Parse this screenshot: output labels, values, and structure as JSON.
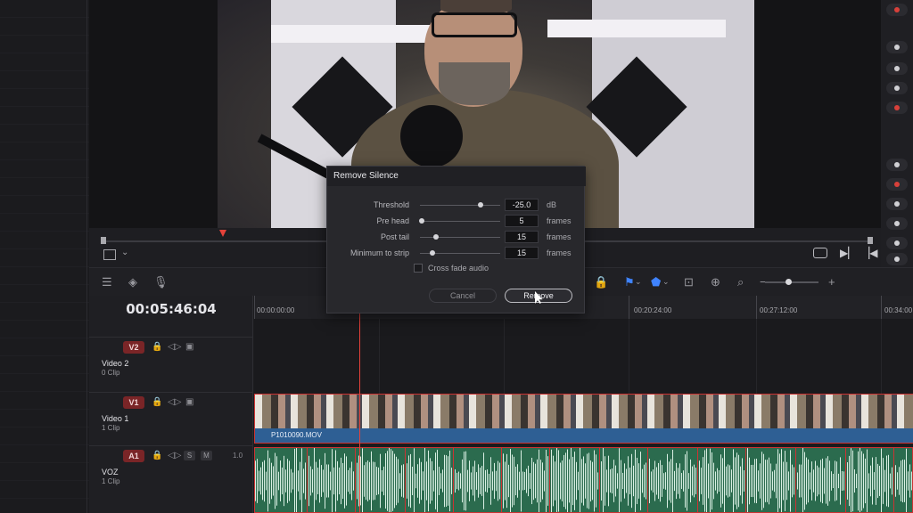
{
  "dialog": {
    "title": "Remove Silence",
    "rows": [
      {
        "label": "Threshold",
        "value": "-25.0",
        "unit": "dB",
        "level": 0.75
      },
      {
        "label": "Pre head",
        "value": "5",
        "unit": "frames",
        "level": 0.02
      },
      {
        "label": "Post tail",
        "value": "15",
        "unit": "frames",
        "level": 0.2
      },
      {
        "label": "Minimum to strip",
        "value": "15",
        "unit": "frames",
        "level": 0.15
      }
    ],
    "crossfade_label": "Cross fade audio",
    "crossfade_checked": false,
    "cancel_label": "Cancel",
    "remove_label": "Remove"
  },
  "timeline": {
    "timecode": "00:05:46:04",
    "ruler": [
      "00:00:00:00",
      "00:20:24:00",
      "00:27:12:00",
      "00:34:00"
    ],
    "tracks": {
      "v2": {
        "badge": "V2",
        "name": "Video 2",
        "clips": "0 Clip"
      },
      "v1": {
        "badge": "V1",
        "name": "Video 1",
        "clips": "1 Clip",
        "clip_name": "P1010090.MOV"
      },
      "a1": {
        "badge": "A1",
        "name": "VOZ",
        "clips": "1 Clip",
        "solo": "S",
        "mute": "M",
        "channel": "1.0"
      }
    }
  },
  "colors": {
    "accent_red": "#e5423a",
    "clip_blue": "#2e5f94",
    "audio_green": "#2b6b4e",
    "icon_blue": "#3f83ff"
  }
}
